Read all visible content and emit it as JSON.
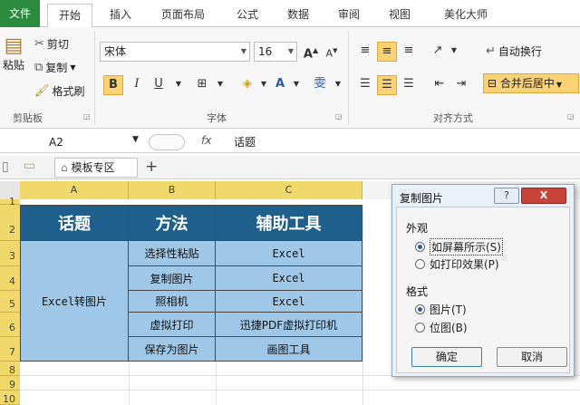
{
  "ribbon_tabs": [
    "文件",
    "开始",
    "插入",
    "页面布局",
    "公式",
    "数据",
    "审阅",
    "视图",
    "美化大师"
  ],
  "active_tab": "开始",
  "clipboard": {
    "paste": "粘贴",
    "cut": "剪切",
    "copy": "复制",
    "format_painter": "格式刷",
    "group_label": "剪贴板"
  },
  "font": {
    "name": "宋体",
    "size": "16",
    "grow": "A",
    "shrink": "A",
    "bold": "B",
    "italic": "I",
    "underline": "U",
    "phonetic": "雯",
    "group_label": "字体"
  },
  "alignment": {
    "wrap": "自动换行",
    "merge": "合并后居中",
    "group_label": "对齐方式"
  },
  "formula_bar": {
    "cell_ref": "A2",
    "fx": "fx",
    "value": "话题"
  },
  "doc_tabs": {
    "template_tab": "模板专区",
    "add": "+"
  },
  "columns": [
    "A",
    "B",
    "C"
  ],
  "rows": [
    "1",
    "2",
    "3",
    "4",
    "5",
    "6",
    "7",
    "8",
    "9",
    "10"
  ],
  "table": {
    "headers": [
      "话题",
      "方法",
      "辅助工具"
    ],
    "topic": "Excel转图片",
    "methods": [
      "选择性粘贴",
      "复制图片",
      "照相机",
      "虚拟打印",
      "保存为图片"
    ],
    "tools": [
      "Excel",
      "Excel",
      "Excel",
      "迅捷PDF虚拟打印机",
      "画图工具"
    ]
  },
  "dialog": {
    "title": "复制图片",
    "help": "?",
    "close": "X",
    "appearance_label": "外观",
    "appearance_options": [
      "如屏幕所示(S)",
      "如打印效果(P)"
    ],
    "appearance_selected": 0,
    "format_label": "格式",
    "format_options": [
      "图片(T)",
      "位图(B)"
    ],
    "format_selected": 0,
    "ok": "确定",
    "cancel": "取消"
  }
}
